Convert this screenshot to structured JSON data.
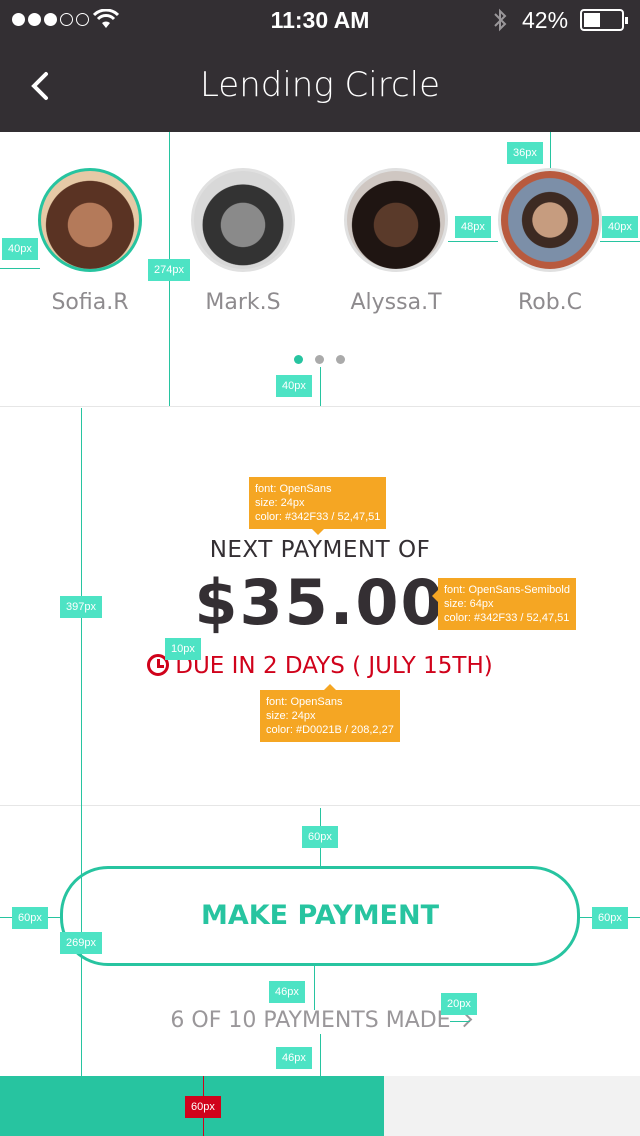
{
  "status_bar": {
    "time": "11:30 AM",
    "battery": "42%",
    "signal_bars": 3,
    "signal_total": 5
  },
  "nav": {
    "title": "Lending Circle"
  },
  "members": [
    {
      "name": "Sofia.R",
      "active": true
    },
    {
      "name": "Mark.S",
      "active": false
    },
    {
      "name": "Alyssa.T",
      "active": false
    },
    {
      "name": "Rob.C",
      "active": false
    }
  ],
  "pager": {
    "pages": 3,
    "current": 1
  },
  "payment": {
    "label": "NEXT PAYMENT OF",
    "amount": "$35.00",
    "due": "DUE IN 2 DAYS ( JULY 15TH)"
  },
  "actions": {
    "make_payment": "MAKE PAYMENT",
    "payments_made": "6 OF 10 PAYMENTS MADE"
  },
  "progress": {
    "made": 6,
    "total": 10
  },
  "annotations": {
    "t_40a": "40px",
    "t_274": "274px",
    "t_36": "36px",
    "t_48": "48px",
    "t_40b": "40px",
    "t_40c": "40px",
    "t_397": "397px",
    "t_10": "10px",
    "t_60a": "60px",
    "t_60b": "60px",
    "t_60c": "60px",
    "t_269": "269px",
    "t_46a": "46px",
    "t_20": "20px",
    "t_46b": "46px",
    "t_60d": "60px",
    "note_label": "font: OpenSans\nsize: 24px\ncolor: #342F33 / 52,47,51",
    "note_amount": "font: OpenSans-Semibold\nsize: 64px\ncolor: #342F33 / 52,47,51",
    "note_due": "font: OpenSans\nsize: 24px\ncolor: #D0021B / 208,2,27"
  },
  "colors": {
    "accent": "#27c4a0",
    "text": "#342F33",
    "alert": "#D0021B",
    "header": "#332f33"
  }
}
